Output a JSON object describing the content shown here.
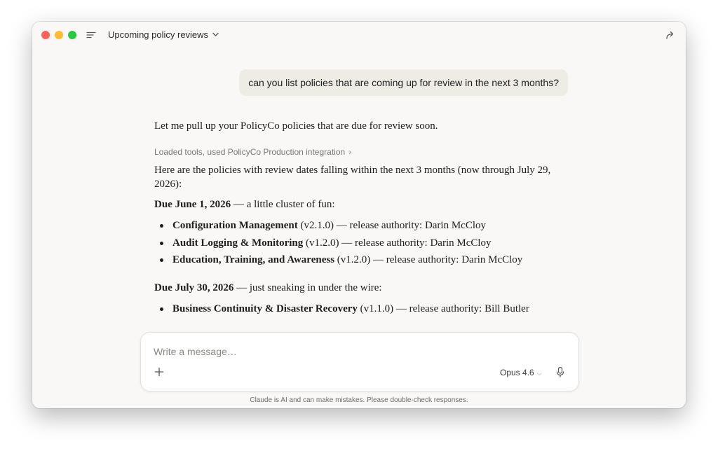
{
  "window": {
    "title": "Upcoming policy reviews"
  },
  "user_message": "can you list policies that are coming up for review in the next 3 months?",
  "response": {
    "intro": "Let me pull up your PolicyCo policies that are due for review soon.",
    "tools_label": "Loaded tools, used PolicyCo Production integration",
    "tools_chevron": "›",
    "summary": "Here are the policies with review dates falling within the next 3 months (now through July 29, 2026):",
    "groups": [
      {
        "heading_bold": "Due June 1, 2026",
        "heading_rest": " — a little cluster of fun:",
        "items": [
          {
            "name": "Configuration Management",
            "detail": " (v2.1.0) — release authority: Darin McCloy"
          },
          {
            "name": "Audit Logging & Monitoring",
            "detail": " (v1.2.0) — release authority: Darin McCloy"
          },
          {
            "name": "Education, Training, and Awareness",
            "detail": " (v1.2.0) — release authority: Darin McCloy"
          }
        ]
      },
      {
        "heading_bold": "Due July 30, 2026",
        "heading_rest": " — just sneaking in under the wire:",
        "items": [
          {
            "name": "Business Continuity & Disaster Recovery",
            "detail": " (v1.1.0) — release authority: Bill Butler"
          }
        ]
      }
    ]
  },
  "composer": {
    "placeholder": "Write a message…",
    "value": "",
    "model": "Opus 4.6",
    "model_chevron": "⌵"
  },
  "disclaimer": "Claude is AI and can make mistakes. Please double-check responses.",
  "icons": {
    "close": "close-traffic-light",
    "minimize": "minimize-traffic-light",
    "zoom": "zoom-traffic-light",
    "menu": "sidebar-menu-icon",
    "title_dropdown": "chevron-down-icon",
    "share": "share-arrow-icon",
    "add": "plus-icon",
    "mic": "microphone-icon"
  },
  "colors": {
    "close": "#ff5f57",
    "minimize": "#febc2e",
    "zoom": "#28c840",
    "window_bg": "#f9f8f6",
    "bubble_bg": "#efece6"
  }
}
